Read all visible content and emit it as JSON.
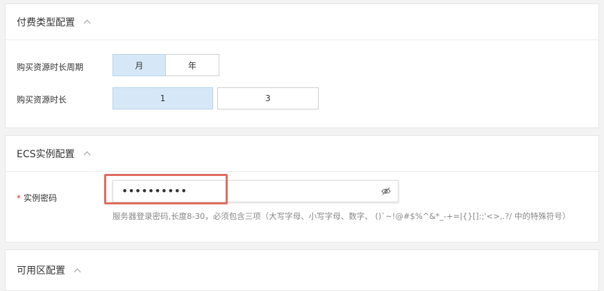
{
  "billing": {
    "title": "付费类型配置",
    "period_label": "购买资源时长周期",
    "period_options": [
      "月",
      "年"
    ],
    "period_selected": "月",
    "duration_label": "购买资源时长",
    "duration_options": [
      "1",
      "3"
    ],
    "duration_selected": "1"
  },
  "ecs": {
    "title": "ECS实例配置",
    "required_mark": "*",
    "password_label": "实例密码",
    "password_value": "••••••••••",
    "password_hint": "服务器登录密码,长度8-30，必须包含三项（大写字母、小写字母、数字、 ()`~!@#$%^&*_-+=|{}[]:;'<>,.?/ 中的特殊符号）"
  },
  "zone": {
    "title": "可用区配置"
  },
  "colors": {
    "selected_bg": "#d6e8f7",
    "highlight_border": "#e06a5e",
    "required": "#e02f2f"
  }
}
